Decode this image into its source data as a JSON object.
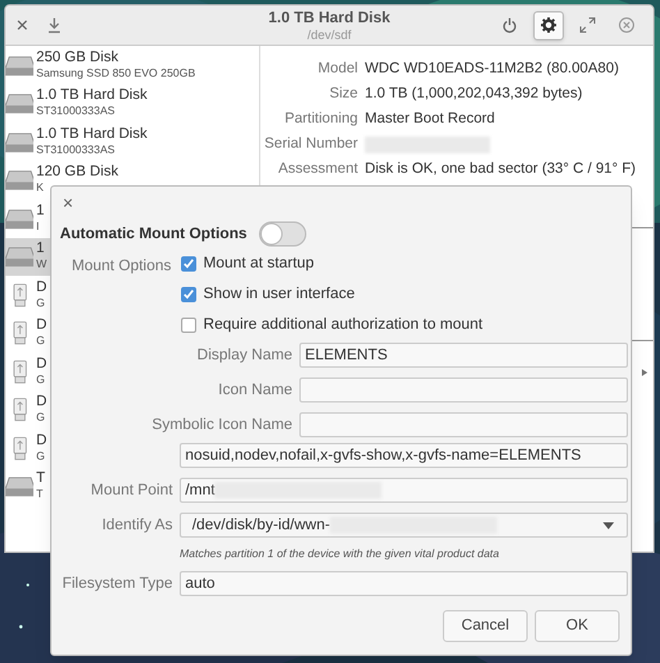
{
  "window": {
    "title": "1.0 TB Hard Disk",
    "subtitle": "/dev/sdf",
    "header_buttons": [
      {
        "kind": "power",
        "selected": false
      },
      {
        "kind": "gear",
        "selected": true
      },
      {
        "kind": "maximize",
        "selected": false
      },
      {
        "kind": "close",
        "selected": false
      }
    ]
  },
  "sidebar": {
    "items": [
      {
        "kind": "hdd",
        "title": "250 GB Disk",
        "subtitle": "Samsung SSD 850 EVO 250GB",
        "selected": false
      },
      {
        "kind": "hdd",
        "title": "1.0 TB Hard Disk",
        "subtitle": "ST31000333AS",
        "selected": false
      },
      {
        "kind": "hdd",
        "title": "1.0 TB Hard Disk",
        "subtitle": "ST31000333AS",
        "selected": false
      },
      {
        "kind": "hdd",
        "title": "120 GB Disk",
        "subtitle": "K",
        "selected": false
      },
      {
        "kind": "hdd",
        "title": "1",
        "subtitle": "I",
        "selected": false
      },
      {
        "kind": "hdd",
        "title": "1",
        "subtitle": "W",
        "selected": true
      },
      {
        "kind": "usb",
        "title": "D",
        "subtitle": "G",
        "selected": false
      },
      {
        "kind": "usb",
        "title": "D",
        "subtitle": "G",
        "selected": false
      },
      {
        "kind": "usb",
        "title": "D",
        "subtitle": "G",
        "selected": false
      },
      {
        "kind": "usb",
        "title": "D",
        "subtitle": "G",
        "selected": false
      },
      {
        "kind": "usb",
        "title": "D",
        "subtitle": "G",
        "selected": false
      },
      {
        "kind": "hdd",
        "title": "T",
        "subtitle": "T",
        "selected": false
      }
    ]
  },
  "details": [
    {
      "label": "Model",
      "value": "WDC WD10EADS-11M2B2 (80.00A80)",
      "blurred": false
    },
    {
      "label": "Size",
      "value": "1.0 TB (1,000,202,043,392 bytes)",
      "blurred": false
    },
    {
      "label": "Partitioning",
      "value": "Master Boot Record",
      "blurred": false
    },
    {
      "label": "Serial Number",
      "blurred": true
    },
    {
      "label": "Assessment",
      "value": "Disk is OK, one bad sector (33° C / 91° F)",
      "blurred": false
    }
  ],
  "dialog": {
    "close": "×",
    "toggle": {
      "label": "Automatic Mount Options",
      "on": false
    },
    "mount_options": {
      "label": "Mount Options",
      "checkboxes": [
        {
          "label": "Mount at startup",
          "checked": true
        },
        {
          "label": "Show in user interface",
          "checked": true
        },
        {
          "label": "Require additional authorization to mount",
          "checked": false
        }
      ]
    },
    "name_fields": [
      {
        "label": "Display Name",
        "value": "ELEMENTS"
      },
      {
        "label": "Icon Name"
      },
      {
        "label": "Symbolic Icon Name"
      }
    ],
    "fields": [
      {
        "kind": "text",
        "value": "nosuid,nodev,nofail,x-gvfs-show,x-gvfs-name=ELEMENTS",
        "blurred": false
      },
      {
        "kind": "text",
        "label": "Mount Point",
        "value": "/mnt",
        "blurred": true
      },
      {
        "kind": "dropdown",
        "label": "Identify As",
        "value": "/dev/disk/by-id/wwn-",
        "blurred": true
      },
      {
        "kind": "hint",
        "value": "Matches partition 1 of the device with the given vital product data"
      },
      {
        "kind": "text",
        "label": "Filesystem Type",
        "value": "auto",
        "blurred": false
      }
    ],
    "buttons": [
      "Cancel",
      "OK"
    ]
  }
}
